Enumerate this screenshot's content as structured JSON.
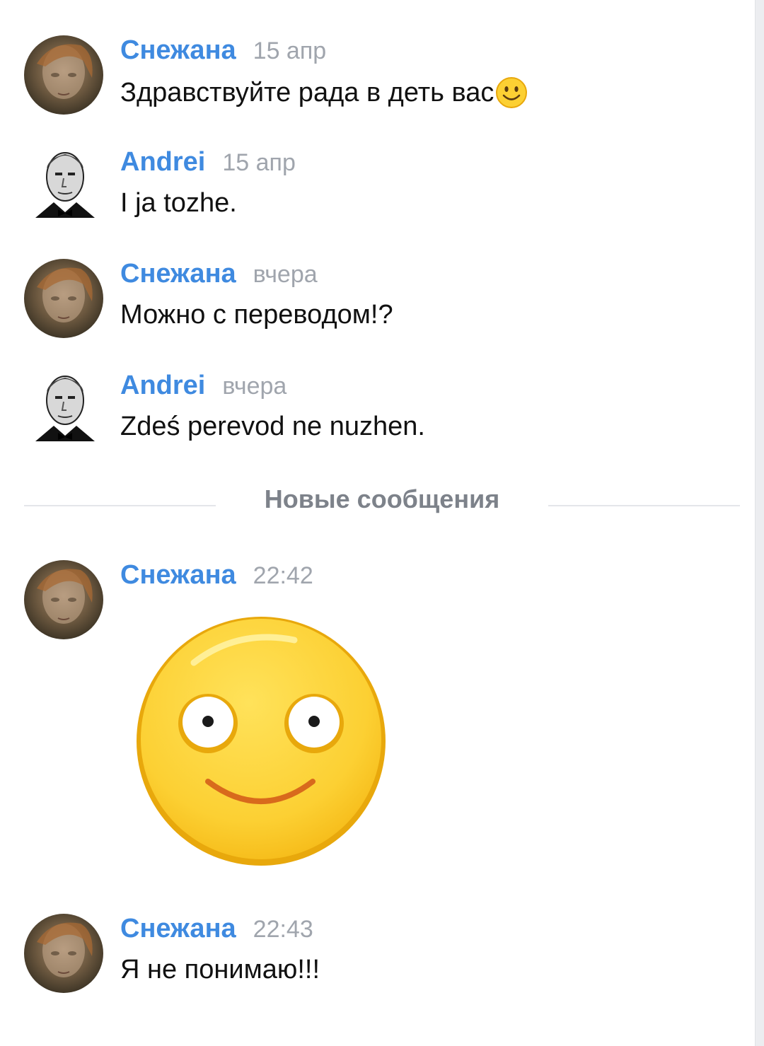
{
  "messages": [
    {
      "author": "Снежана",
      "time": "15 апр",
      "text": "Здравствуйте рада в деть вас",
      "avatar_icon": "user-photo-snezhana",
      "inline_emoji": "slightly-smiling-face-icon"
    },
    {
      "author": "Andrei",
      "time": "15 апр",
      "text": "I ja tozhe.",
      "avatar_icon": "user-photo-andrei"
    },
    {
      "author": "Снежана",
      "time": "вчера",
      "text": "Можно с переводом!?",
      "avatar_icon": "user-photo-snezhana"
    },
    {
      "author": "Andrei",
      "time": "вчера",
      "text": "Zdeś perevod ne nuzhen.",
      "avatar_icon": "user-photo-andrei"
    },
    {
      "author": "Снежана",
      "time": "22:42",
      "sticker": "smiley-face-sticker",
      "avatar_icon": "user-photo-snezhana"
    },
    {
      "author": "Снежана",
      "time": "22:43",
      "text": "Я не понимаю!!!",
      "avatar_icon": "user-photo-snezhana"
    }
  ],
  "divider": {
    "label": "Новые сообщения"
  },
  "colors": {
    "author_name": "#3f8ae0",
    "timestamp": "#a0a5ad",
    "message_text": "#111111",
    "divider_label": "#7d828a",
    "sticker_face": "#fcd033",
    "sticker_outline": "#e8a80c",
    "sticker_mouth": "#d86a1c"
  }
}
